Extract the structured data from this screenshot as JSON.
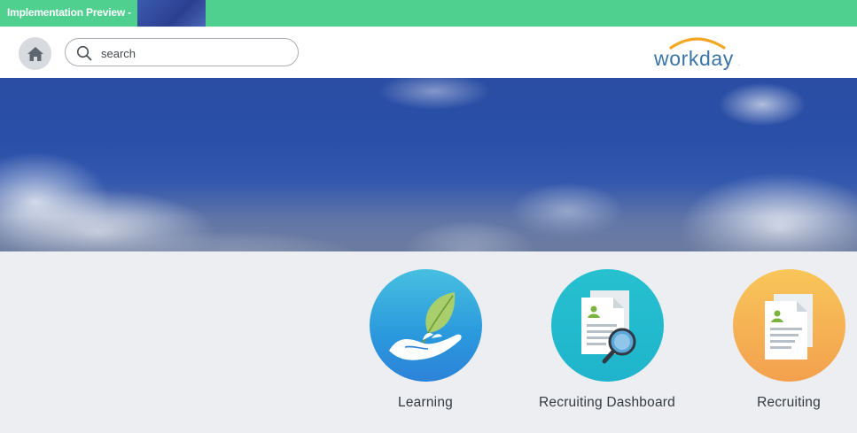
{
  "env_banner": {
    "label": "Implementation Preview -"
  },
  "header": {
    "home_icon": "home-icon",
    "search": {
      "placeholder": "search",
      "value": ""
    },
    "logo_text": "workday"
  },
  "apps": [
    {
      "label": "Learning",
      "icon": "hand-leaf-icon"
    },
    {
      "label": "Recruiting Dashboard",
      "icon": "document-magnifier-icon"
    },
    {
      "label": "Recruiting",
      "icon": "documents-icon"
    }
  ],
  "colors": {
    "env_banner": "#4fd08e",
    "logo_blue": "#3a74a8",
    "logo_arc": "#f5a623",
    "learning": "#2a98dd",
    "recruiting_dashboard": "#1fb4cc",
    "recruiting": "#f3a04e"
  }
}
